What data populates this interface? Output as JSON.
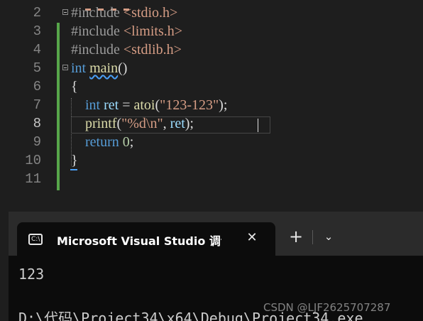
{
  "editor": {
    "lines": [
      {
        "number": "2",
        "parts": {
          "a": "#include",
          "b": " <stdio.h>"
        }
      },
      {
        "number": "3",
        "parts": {
          "a": "#include",
          "b": " <limits.h>"
        }
      },
      {
        "number": "4",
        "parts": {
          "a": "#include",
          "b": " <stdlib.h>"
        }
      },
      {
        "number": "5",
        "parts": {
          "a": "int",
          "b": " ",
          "c": "main",
          "d": "()"
        }
      },
      {
        "number": "6",
        "parts": {
          "a": "{"
        }
      },
      {
        "number": "7",
        "parts": {
          "a": "    int",
          "b": " ",
          "c": "ret",
          "d": " = ",
          "e": "atoi",
          "f": "(",
          "g": "\"123-123\"",
          "h": ");"
        }
      },
      {
        "number": "8",
        "parts": {
          "a": "    printf",
          "b": "(",
          "c": "\"%d\\n\"",
          "d": ", ",
          "e": "ret",
          "f": ");"
        }
      },
      {
        "number": "9",
        "parts": {
          "a": "    return",
          "b": " ",
          "c": "0",
          "d": ";"
        }
      },
      {
        "number": "10",
        "parts": {
          "a": "}"
        }
      },
      {
        "number": "11",
        "parts": {}
      }
    ],
    "current_line": "8"
  },
  "console": {
    "tab_title": "Microsoft Visual Studio 调试控制台",
    "tab_icon_glyph": "C:\\",
    "close_glyph": "✕",
    "new_tab_glyph": "+",
    "dropdown_glyph": "⌄",
    "output": [
      "123",
      "D:\\代码\\Project34\\x64\\Debug\\Project34.exe"
    ]
  },
  "watermark": "CSDN @LJF2625707287",
  "colors": {
    "keyword": "#569cd6",
    "function": "#dcdcaa",
    "variable": "#9cdcfe",
    "string": "#d69d85",
    "number": "#b5cea8",
    "change_bar": "#57a64a"
  },
  "icons": [
    "terminal-icon",
    "close-icon",
    "plus-icon",
    "chevron-down-icon",
    "fold-icon"
  ]
}
